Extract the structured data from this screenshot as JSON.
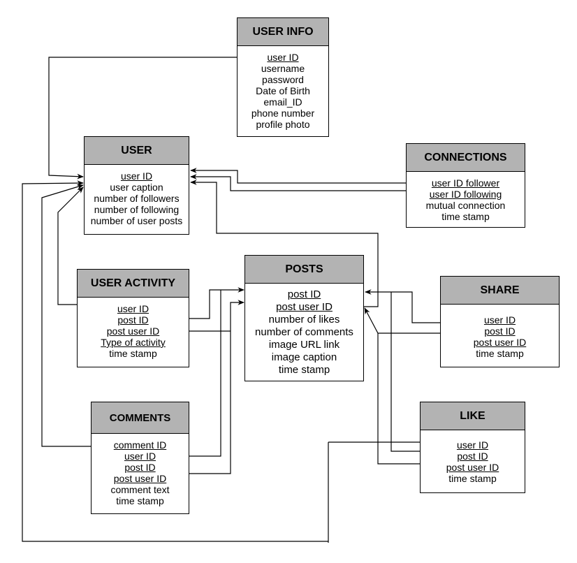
{
  "diagram": {
    "type": "entity-relationship",
    "entities": [
      {
        "id": "user_info",
        "title": "USER INFO",
        "attributes": [
          {
            "name": "user ID",
            "key": true
          },
          {
            "name": "username",
            "key": false
          },
          {
            "name": "password",
            "key": false
          },
          {
            "name": "Date of Birth",
            "key": false
          },
          {
            "name": "email_ID",
            "key": false
          },
          {
            "name": "phone number",
            "key": false
          },
          {
            "name": "profile photo",
            "key": false
          }
        ]
      },
      {
        "id": "user",
        "title": "USER",
        "attributes": [
          {
            "name": "user ID",
            "key": true
          },
          {
            "name": "user caption",
            "key": false
          },
          {
            "name": "number of followers",
            "key": false
          },
          {
            "name": "number of following",
            "key": false
          },
          {
            "name": "number of user posts",
            "key": false
          }
        ]
      },
      {
        "id": "connections",
        "title": "CONNECTIONS",
        "attributes": [
          {
            "name": "user ID follower",
            "key": true
          },
          {
            "name": "user ID following",
            "key": true
          },
          {
            "name": "mutual connection",
            "key": false
          },
          {
            "name": "time stamp",
            "key": false
          }
        ]
      },
      {
        "id": "posts",
        "title": "POSTS",
        "attributes": [
          {
            "name": "post ID",
            "key": true
          },
          {
            "name": "post user ID",
            "key": true
          },
          {
            "name": "number of likes",
            "key": false
          },
          {
            "name": "number of comments",
            "key": false
          },
          {
            "name": "image URL link",
            "key": false
          },
          {
            "name": "image caption",
            "key": false
          },
          {
            "name": "time stamp",
            "key": false
          }
        ]
      },
      {
        "id": "user_activity",
        "title": "USER ACTIVITY",
        "attributes": [
          {
            "name": "user ID",
            "key": true
          },
          {
            "name": "post ID",
            "key": true
          },
          {
            "name": "post user ID",
            "key": true
          },
          {
            "name": "Type of activity",
            "key": true
          },
          {
            "name": "time stamp",
            "key": false
          }
        ]
      },
      {
        "id": "share",
        "title": "SHARE",
        "attributes": [
          {
            "name": "user ID",
            "key": true
          },
          {
            "name": "post ID",
            "key": true
          },
          {
            "name": "post user ID",
            "key": true
          },
          {
            "name": "time stamp",
            "key": false
          }
        ]
      },
      {
        "id": "comments",
        "title": "COMMENTS",
        "attributes": [
          {
            "name": "comment ID",
            "key": true
          },
          {
            "name": "user ID",
            "key": true
          },
          {
            "name": "post ID",
            "key": true
          },
          {
            "name": "post user ID",
            "key": true
          },
          {
            "name": "comment text",
            "key": false
          },
          {
            "name": "time stamp",
            "key": false
          }
        ]
      },
      {
        "id": "like",
        "title": "LIKE",
        "attributes": [
          {
            "name": "user ID",
            "key": true
          },
          {
            "name": "post ID",
            "key": true
          },
          {
            "name": "post user ID",
            "key": true
          },
          {
            "name": "time stamp",
            "key": false
          }
        ]
      }
    ],
    "relationships": [
      {
        "from": "user_info.user ID",
        "to": "user.user ID"
      },
      {
        "from": "like.user ID",
        "to": "user.user ID"
      },
      {
        "from": "comments.user ID",
        "to": "user.user ID"
      },
      {
        "from": "user_activity.user ID",
        "to": "user.user ID"
      },
      {
        "from": "connections.user ID follower",
        "to": "user.user ID"
      },
      {
        "from": "connections.user ID following",
        "to": "user.user ID"
      },
      {
        "from": "posts.post user ID",
        "to": "user.user ID"
      },
      {
        "from": "user_activity.post ID",
        "to": "posts.post ID"
      },
      {
        "from": "user_activity.post user ID",
        "to": "posts.post user ID"
      },
      {
        "from": "comments.post ID",
        "to": "posts.post ID"
      },
      {
        "from": "comments.post user ID",
        "to": "posts.post user ID"
      },
      {
        "from": "share.user ID",
        "to": "posts.post ID"
      },
      {
        "from": "like.post ID",
        "to": "posts.post ID"
      },
      {
        "from": "share.post ID",
        "to": "posts.post user ID"
      },
      {
        "from": "like.post user ID",
        "to": "posts.post user ID"
      }
    ]
  },
  "colors": {
    "header_fill": "#b3b3b3",
    "body_fill": "#ffffff",
    "stroke": "#000000"
  }
}
